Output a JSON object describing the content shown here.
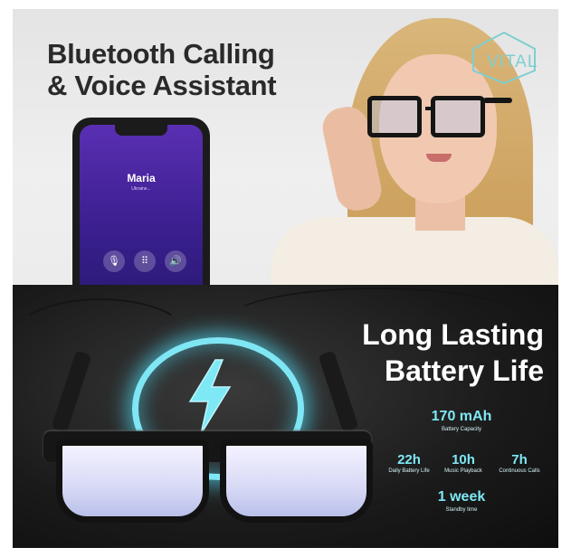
{
  "top": {
    "headline_line1": "Bluetooth Calling",
    "headline_line2": "& Voice Assistant",
    "logo": "VITAL",
    "phone": {
      "caller_name": "Maria",
      "caller_subtitle": "Ukraine...",
      "buttons": [
        "mute-icon",
        "keypad-icon",
        "speaker-icon"
      ]
    }
  },
  "bottom": {
    "title_line1": "Long Lasting",
    "title_line2": "Battery Life",
    "capacity_value": "170 mAh",
    "capacity_label": "Battery Capacity",
    "stats": [
      {
        "value": "22h",
        "label": "Daily Battery Life"
      },
      {
        "value": "10h",
        "label": "Music Playback"
      },
      {
        "value": "7h",
        "label": "Continuous Calls"
      }
    ],
    "standby_value": "1 week",
    "standby_label": "Standby time"
  },
  "colors": {
    "accent_cyan": "#7ee8f5",
    "phone_purple": "#4a28a0",
    "logo_teal": "#7ecfd0"
  }
}
